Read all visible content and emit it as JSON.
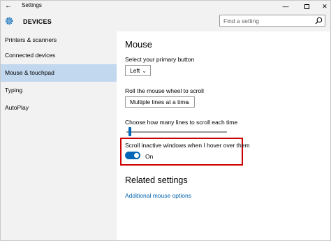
{
  "titlebar": {
    "back_glyph": "←",
    "title": "Settings",
    "minimize_glyph": "—",
    "close_glyph": "✕"
  },
  "header": {
    "title": "DEVICES",
    "icon": "gear-icon"
  },
  "search": {
    "placeholder": "Find a setting",
    "icon": "search-icon"
  },
  "sidebar": {
    "items": [
      {
        "label": "Printers & scanners",
        "active": false
      },
      {
        "label": "Connected devices",
        "active": false
      },
      {
        "label": "Mouse & touchpad",
        "active": true
      },
      {
        "label": "Typing",
        "active": false
      },
      {
        "label": "AutoPlay",
        "active": false
      }
    ]
  },
  "main": {
    "title": "Mouse",
    "primary_button": {
      "label": "Select your primary button",
      "value": "Left"
    },
    "scroll_mode": {
      "label": "Roll the mouse wheel to scroll",
      "value": "Multiple lines at a time"
    },
    "scroll_lines": {
      "label": "Choose how many lines to scroll each time",
      "level_fraction": 0.02
    },
    "inactive_scroll": {
      "label": "Scroll inactive windows when I hover over them",
      "state": "On",
      "enabled": true
    },
    "related": {
      "title": "Related settings",
      "link": "Additional mouse options"
    }
  },
  "colors": {
    "accent": "#0067b8",
    "sidebar_bg": "#f2f2f2",
    "selected_item": "#c1d8ee",
    "highlight_border": "#cc0000",
    "link": "#0063b1"
  }
}
